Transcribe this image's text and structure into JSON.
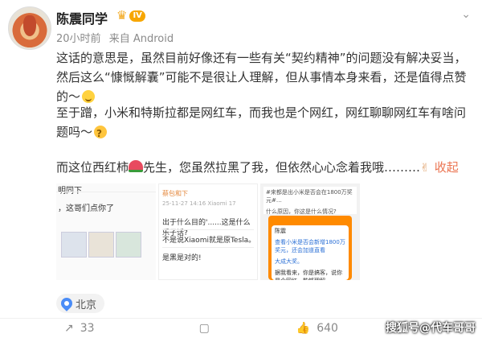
{
  "post": {
    "username": "陈震同学",
    "level": "IV",
    "time": "20小时前",
    "source": "来自 Android",
    "para1": "这话的意思是，虽然目前好像还有一些有关“契约精神”的问题没有解决妥当，然后这么“慷慨解囊”可能不是很让人理解，但从事情本身来看，还是值得点赞的～",
    "para2": "至于蹭，小米和特斯拉都是网红车，而我也是个网红，网红聊聊网红车有啥问题吗～",
    "para3_a": "而这位西红柿",
    "para3_b": "先生，您虽然拉黑了我，但依然心心念着我哦………",
    "collapse": "收起",
    "location": "北京",
    "shares": "33",
    "comments": "",
    "likes": "640"
  },
  "images": {
    "img1": {
      "title": "明同下",
      "msg": "，这哥们点你了"
    },
    "img2": {
      "head": "蔡包和下",
      "sub": "25-11-27 14:16  Xiaomi 17",
      "r1": "出于什么目的'......这是什么乐子话?",
      "r2": "不是说Xiaomi就是原Tesla。",
      "r3": "是黑是对的!"
    },
    "img3": {
      "bar1": "#来都是出小米是否会在1800万奖元#…",
      "bar2": "什么原因，你这是什么情况?",
      "p1": "陈震",
      "p2": "查看小米是否会新增1800万奖元，还会加道直看",
      "p3": "大成大奖。",
      "p4": "据我看来，你是搞客，说你是个网红，能够理解，",
      "p5": "..."
    }
  },
  "watermark": "搜狐号@代车哥哥"
}
